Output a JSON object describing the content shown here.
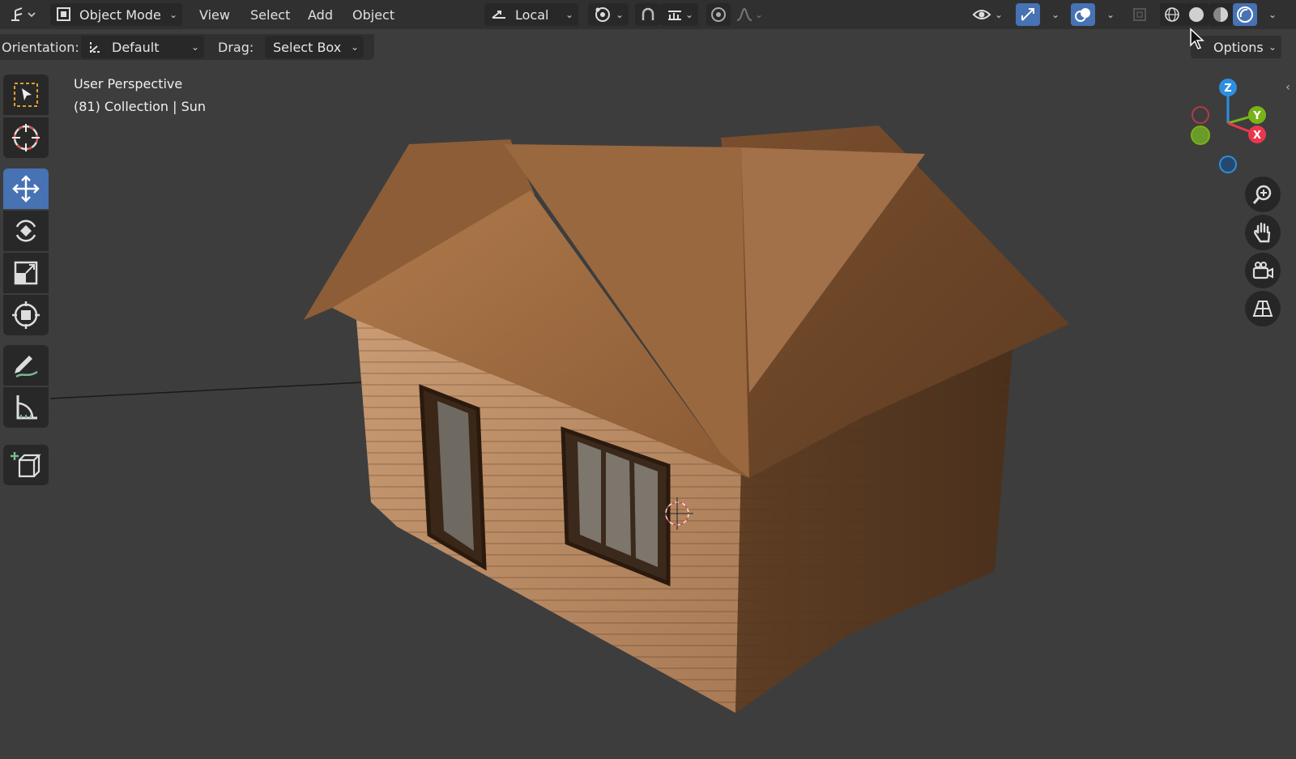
{
  "header": {
    "editor_type_icon": "view3d-editor-icon",
    "mode": {
      "label": "Object Mode",
      "icon": "object-mode-icon"
    },
    "menus": [
      "View",
      "Select",
      "Add",
      "Object"
    ],
    "transform_orientation": {
      "label": "Local",
      "icon": "transform-orientation-icon"
    },
    "pivot_icon": "pivot-point-icon",
    "snap_icon": "magnet-snap-icon",
    "snap_target_icon": "snap-increment-icon",
    "proportional_icon": "proportional-edit-icon",
    "falloff_icon": "falloff-curve-icon",
    "visibility_icon": "eye-visibility-icon",
    "gizmo_icon": "gizmo-icon",
    "overlay_icon": "overlays-icon",
    "xray_icon": "xray-icon",
    "shading_icons": [
      "wireframe-shading-icon",
      "solid-shading-icon",
      "material-preview-icon",
      "rendered-shading-icon"
    ]
  },
  "subheader": {
    "orientation_label": "Orientation:",
    "orientation_value": "Default",
    "drag_label": "Drag:",
    "drag_value": "Select Box",
    "options_label": "Options"
  },
  "viewport": {
    "view_name": "User Perspective",
    "collection_line": "(81) Collection | Sun",
    "scene": "wooden house with gabled roof"
  },
  "toolbar": {
    "tools": [
      "select-box-icon",
      "cursor-icon",
      "move-icon",
      "rotate-icon",
      "scale-icon",
      "transform-icon",
      "annotate-icon",
      "measure-icon",
      "add-cube-icon"
    ],
    "active_tool": "move-icon"
  },
  "gizmo": {
    "x": "X",
    "y": "Y",
    "z": "Z"
  },
  "navigation": [
    "zoom-icon",
    "pan-hand-icon",
    "camera-view-icon",
    "perspective-toggle-icon"
  ],
  "colors": {
    "accent": "#4772b3",
    "axis_x": "#e8384f",
    "axis_y": "#7ab317",
    "axis_z": "#2c8fe0",
    "viewport_bg": "#3d3d3d",
    "header_bg": "#303030"
  }
}
